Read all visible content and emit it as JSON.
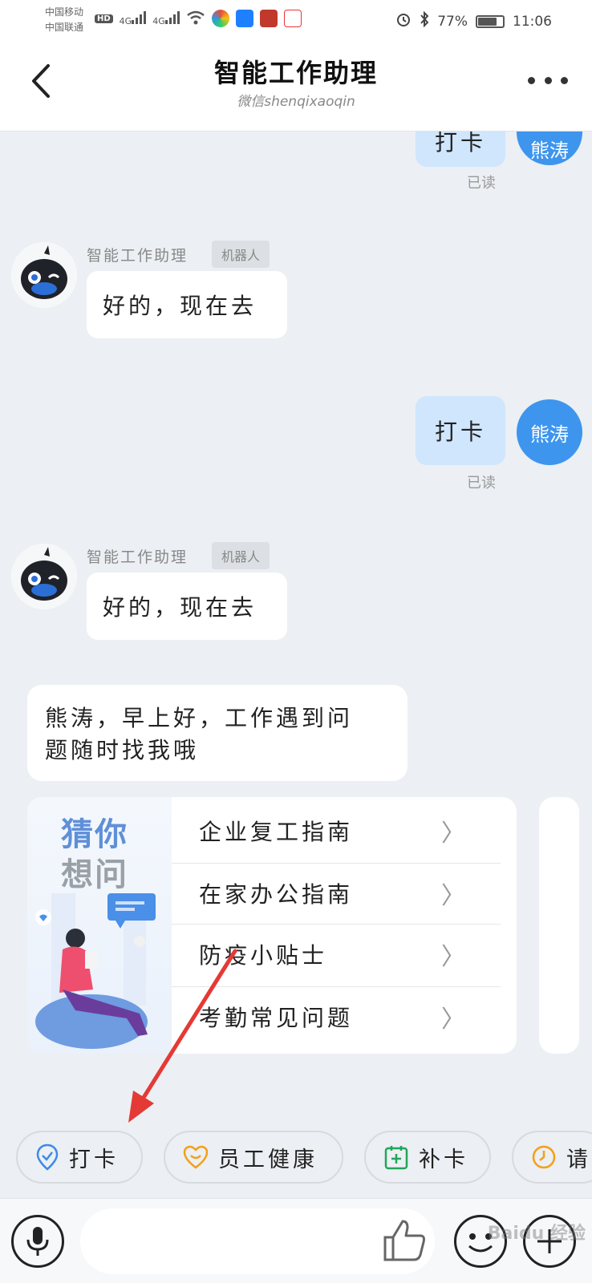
{
  "status_bar": {
    "carrier1": "中国移动",
    "carrier2": "中国联通",
    "hd": "HD",
    "net1": "4G",
    "net2": "4G",
    "battery_percent": "77%",
    "battery_level": 0.77,
    "time": "11:06"
  },
  "header": {
    "title": "智能工作助理",
    "subtitle": "微信shenqixaoqin"
  },
  "messages": {
    "out_top": {
      "text": "打卡",
      "sender": "熊涛",
      "read": "已读"
    },
    "bot1": {
      "name": "智能工作助理",
      "tag": "机器人",
      "text": "好的，现在去"
    },
    "out2": {
      "text": "打卡",
      "sender": "熊涛",
      "read": "已读"
    },
    "bot2": {
      "name": "智能工作助理",
      "tag": "机器人",
      "text": "好的，现在去"
    },
    "greeting": {
      "line1": "熊涛，早上好，工作遇到问",
      "line2": "题随时找我哦"
    }
  },
  "card": {
    "title_line1": "猜你",
    "title_line2": "想问",
    "items": [
      {
        "label": "企业复工指南"
      },
      {
        "label": "在家办公指南"
      },
      {
        "label": "防疫小贴士"
      },
      {
        "label": "考勤常见问题"
      }
    ],
    "chevron": "〉"
  },
  "quick_replies": [
    {
      "label": "打卡",
      "icon": "location-check-icon",
      "color": "#3d8ae8"
    },
    {
      "label": "员工健康",
      "icon": "heart-smile-icon",
      "color": "#f2a019"
    },
    {
      "label": "补卡",
      "icon": "calendar-plus-icon",
      "color": "#22a55a"
    },
    {
      "label": "请",
      "icon": "clock-icon",
      "color": "#f2a019"
    }
  ],
  "input_bar": {
    "placeholder": ""
  },
  "watermark": "Baidu 经验",
  "colors": {
    "accent": "#3d95ee",
    "bubble_out": "#cfe6fc",
    "background": "#eceff3",
    "arrow": "#e53935"
  }
}
